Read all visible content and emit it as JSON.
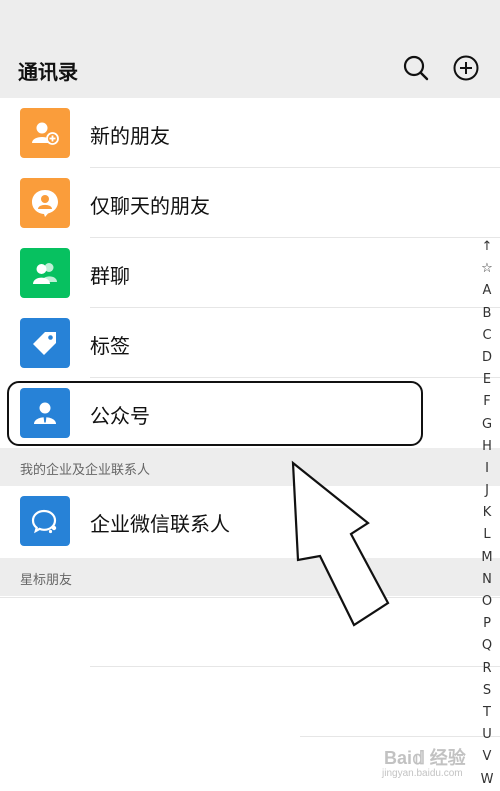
{
  "header": {
    "title": "通讯录"
  },
  "rows": [
    {
      "label": "新的朋友",
      "icon": "add-friend-icon",
      "color": "#fa9d3b"
    },
    {
      "label": "仅聊天的朋友",
      "icon": "chat-only-friend-icon",
      "color": "#fa9d3b"
    },
    {
      "label": "群聊",
      "icon": "group-chat-icon",
      "color": "#07c160"
    },
    {
      "label": "标签",
      "icon": "tag-icon",
      "color": "#2782d7"
    },
    {
      "label": "公众号",
      "icon": "official-account-icon",
      "color": "#2782d7"
    }
  ],
  "sections": [
    {
      "title": "我的企业及企业联系人"
    },
    {
      "title": "星标朋友"
    }
  ],
  "enterprise_row": {
    "label": "企业微信联系人",
    "icon": "work-wechat-contact-icon",
    "color": "#2782d7"
  },
  "index_bar": [
    "↑",
    "☆",
    "A",
    "B",
    "C",
    "D",
    "E",
    "F",
    "G",
    "H",
    "I",
    "J",
    "K",
    "L",
    "M",
    "N",
    "O",
    "P",
    "Q",
    "R",
    "S",
    "T",
    "U",
    "V",
    "W"
  ],
  "watermark": {
    "main": "Bai𝕕 经验",
    "sub": "jingyan.baidu.com"
  }
}
